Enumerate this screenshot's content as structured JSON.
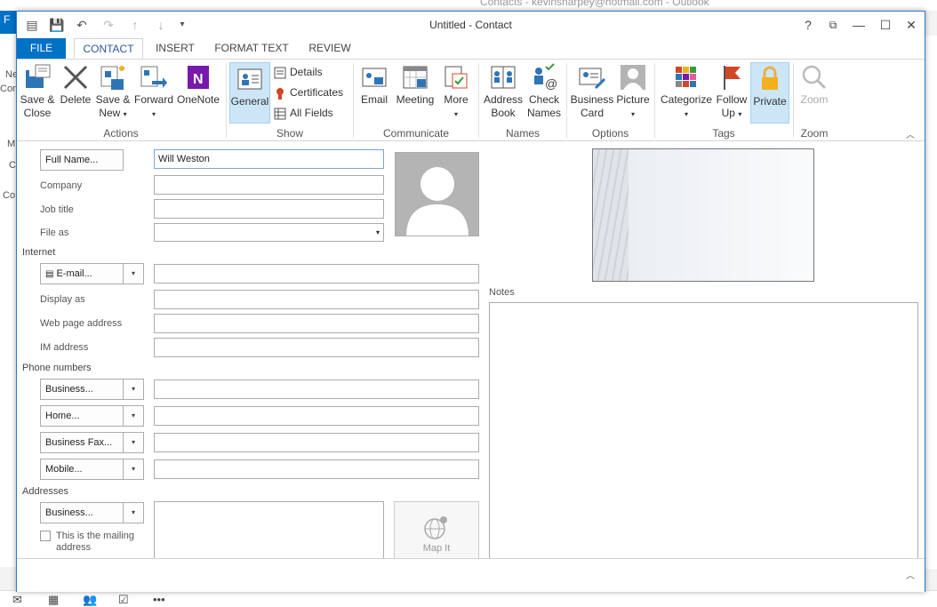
{
  "background": {
    "title": "Contacts - kevinsharpey@hotmail.com - Outlook",
    "file": "F",
    "left_fragments": [
      "Ne",
      "Con",
      "M",
      "C",
      "Co"
    ]
  },
  "window": {
    "title": "Untitled - Contact",
    "help": "?",
    "restore": "⧉",
    "minimize": "—",
    "maximize": "☐",
    "close": "✕"
  },
  "tabs": [
    "FILE",
    "CONTACT",
    "INSERT",
    "FORMAT TEXT",
    "REVIEW"
  ],
  "ribbon": {
    "actions": {
      "save_close": [
        "Save &",
        "Close"
      ],
      "delete": "Delete",
      "save_new": [
        "Save &",
        "New"
      ],
      "forward": "Forward",
      "onenote": "OneNote",
      "group": "Actions"
    },
    "show": {
      "general": "General",
      "details": "Details",
      "certificates": "Certificates",
      "all_fields": "All Fields",
      "group": "Show"
    },
    "communicate": {
      "email": "Email",
      "meeting": "Meeting",
      "more": "More",
      "group": "Communicate"
    },
    "names": {
      "address_book": [
        "Address",
        "Book"
      ],
      "check_names": [
        "Check",
        "Names"
      ],
      "group": "Names"
    },
    "options": {
      "business_card": [
        "Business",
        "Card"
      ],
      "picture": "Picture",
      "group": "Options"
    },
    "tags": {
      "categorize": "Categorize",
      "follow_up": [
        "Follow",
        "Up"
      ],
      "private": "Private",
      "group": "Tags"
    },
    "zoom": {
      "zoom": "Zoom",
      "group": "Zoom"
    }
  },
  "form": {
    "full_name_btn": "Full Name...",
    "full_name_value": "Will Weston",
    "company": "Company",
    "job_title": "Job title",
    "file_as": "File as",
    "internet": "Internet",
    "email_btn": "E-mail...",
    "display_as": "Display as",
    "web_page": "Web page address",
    "im_address": "IM address",
    "phone_numbers": "Phone numbers",
    "phones": [
      "Business...",
      "Home...",
      "Business Fax...",
      "Mobile..."
    ],
    "addresses": "Addresses",
    "address_btn": "Business...",
    "mailing_check": [
      "This is the mailing",
      "address"
    ],
    "map_it": "Map It",
    "notes": "Notes"
  },
  "colors": {
    "accent": "#0072c6",
    "selected": "#cde6f7"
  }
}
